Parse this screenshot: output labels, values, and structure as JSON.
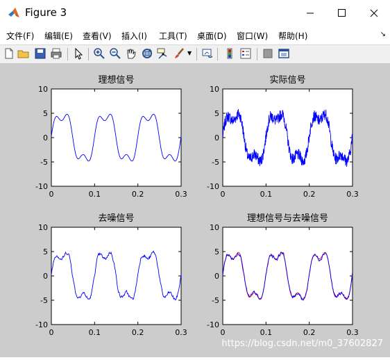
{
  "window": {
    "title": "Figure 3"
  },
  "menu": {
    "items": [
      "文件(F)",
      "编辑(E)",
      "查看(V)",
      "插入(I)",
      "工具(T)",
      "桌面(D)",
      "窗口(W)",
      "帮助(H)"
    ]
  },
  "toolbar": {
    "icons": [
      "new-file-icon",
      "open-folder-icon",
      "save-icon",
      "print-icon",
      "pointer-icon",
      "zoom-in-icon",
      "zoom-out-icon",
      "pan-icon",
      "rotate-icon",
      "data-cursor-icon",
      "brush-icon",
      "link-icon",
      "colorbar-icon",
      "legend-icon",
      "hide-tools-icon",
      "dock-icon"
    ]
  },
  "watermark": "https://blog.csdn.net/m0_37602827",
  "colors": {
    "signal": "#0000ff",
    "denoised_overlay": "#ff0000",
    "figure_bg": "#cccccc",
    "axes_bg": "#ffffff"
  },
  "chart_data": [
    {
      "type": "line",
      "title": "理想信号",
      "xlim": [
        0,
        0.3
      ],
      "ylim": [
        -10,
        10
      ],
      "xticks": [
        "0",
        "0.1",
        "0.2",
        "0.3"
      ],
      "yticks": [
        "10",
        "5",
        "0",
        "-5",
        "-10"
      ],
      "series": [
        {
          "noise": 0,
          "values_desc": "smooth",
          "x": [
            0,
            0.3
          ]
        }
      ]
    },
    {
      "type": "line",
      "title": "实际信号",
      "xlim": [
        0,
        0.3
      ],
      "ylim": [
        -10,
        10
      ],
      "xticks": [
        "0",
        "0.1",
        "0.2",
        "0.3"
      ],
      "yticks": [
        "10",
        "5",
        "0",
        "-5",
        "-10"
      ],
      "series": [
        {
          "noise": 1.2,
          "x": [
            0,
            0.3
          ]
        }
      ]
    },
    {
      "type": "line",
      "title": "去噪信号",
      "xlim": [
        0,
        0.3
      ],
      "ylim": [
        -10,
        10
      ],
      "xticks": [
        "0",
        "0.1",
        "0.2",
        "0.3"
      ],
      "yticks": [
        "10",
        "5",
        "0",
        "-5",
        "-10"
      ],
      "series": [
        {
          "noise": 0.45,
          "x": [
            0,
            0.3
          ]
        }
      ]
    },
    {
      "type": "line",
      "title": "理想信号与去噪信号",
      "xlim": [
        0,
        0.3
      ],
      "ylim": [
        -10,
        10
      ],
      "xticks": [
        "0",
        "0.1",
        "0.2",
        "0.3"
      ],
      "yticks": [
        "10",
        "5",
        "0",
        "-5",
        "-10"
      ],
      "series": [
        {
          "noise": 0,
          "x": [
            0,
            0.3
          ]
        },
        {
          "noise": 0.45,
          "x": [
            0,
            0.3
          ]
        }
      ]
    }
  ]
}
